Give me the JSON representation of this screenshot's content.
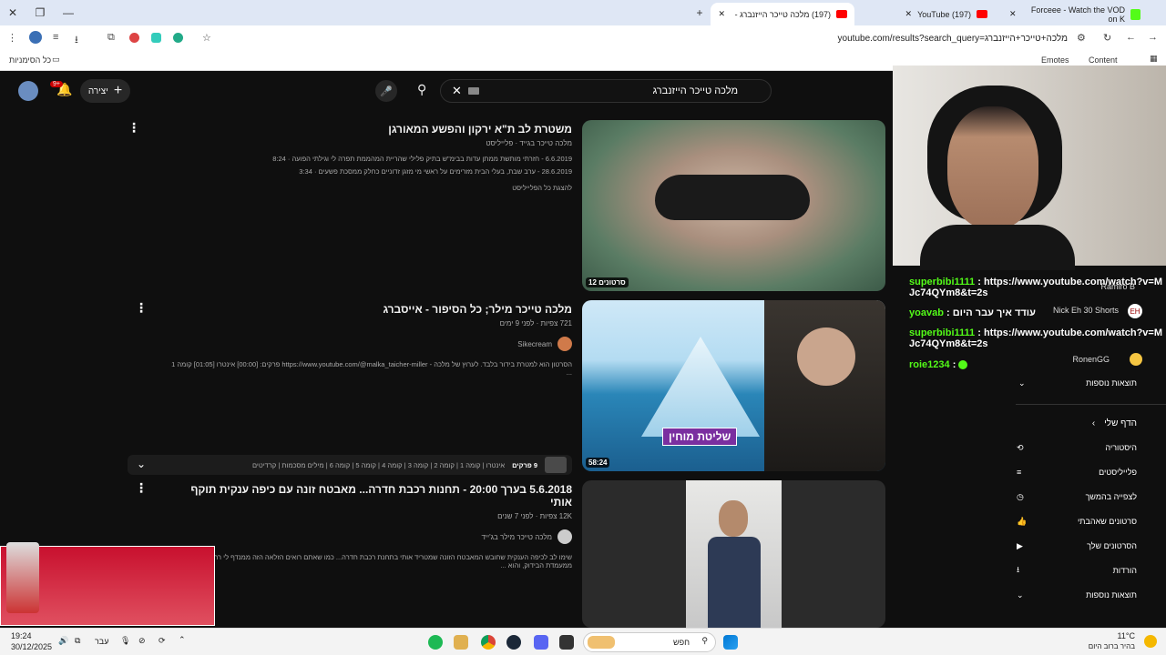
{
  "browser": {
    "tabs": [
      {
        "label": "Forceee - Watch the VOD on K"
      },
      {
        "label": "(197) YouTube"
      },
      {
        "label": "(197) מלכה טייכר הייזנברג - ‏"
      }
    ],
    "url": "youtube.com/results?search_query=מלכה+טייכר+הייזנברג",
    "bookmarks": {
      "all": "כל הסימניות",
      "content": "Content",
      "emotes": "Emotes"
    }
  },
  "yt": {
    "search_value": "מלכה טייכר הייזנברג",
    "create_label": "יצירה",
    "notif_count": "9+",
    "results": [
      {
        "title": "משטרת לב ת\"א ירקון והפשע המאורגן",
        "channel": "מלכה טייכר בגייד · פלייליסט",
        "line1": "6.6.2019 - חזרתי מותשת ממתן עדות בבימ\"ש בתיק פלילי שהריית המהממת תפרה לי וגילתי הפועה · 8:24",
        "line2": "28.6.2019 - ערב שבת, בעלי הבית מזרימים על ראשי מי מזגן זדוניים כחלק ממסכת פשעים · 3:34",
        "link": "להצגת כל הפלייליסט",
        "badge": "12 סרטונים"
      },
      {
        "title": "מלכה טייכר מילר; כל הסיפור - אייסברג",
        "stats": "721 צפיות · לפני 9 ימים",
        "channel": "Sikecream",
        "desc": "הסרטון הוא למטרת בידור בלבד. לערוץ של מלכה - https://www.youtube.com/@malka_taicher-miller פרקים: [00:00] אינטרו [01:05] קומה 1 ...",
        "chapters_label": "9 פרקים",
        "chapters": "אינטרו | קומה 1 | קומה 2 | קומה 3 | קומה 4 | קומה 5 | קומה 6 | מילים מסכמות | קרדיטים",
        "duration": "58:24",
        "overlay_text": "שליטת מוחין"
      },
      {
        "title": "5.6.2018 בערך 20:00 - תחנות רכבת חדרה... מאבטח זונה עם כיפה ענקית תוקף אותי",
        "stats": "12K צפיות · לפני 7 שנים",
        "channel": "מלכה טייכר מילר בג'ייד",
        "desc": "שימו לב לכיפה הענקית שחובש המאבטח הזונה שמטריד אותי בתחנת רכבת חדרה... כמו שאתם רואים הזלאה הזה ממנדף לי רחוק ממעמדת הבידוק, והוא ..."
      }
    ]
  },
  "chat": [
    {
      "user": "superbibi1111",
      "text": "https://www.youtube.com/watch?v=MJc74QYm8&t=2s"
    },
    {
      "user": "yoavab",
      "text": "עודד איך עבר היום"
    },
    {
      "user": "superbibi1111",
      "text": "https://www.youtube.com/watch?v=MJc74QYm8&t=2s"
    },
    {
      "user": "roie1234",
      "text": ""
    }
  ],
  "subs": [
    "Ramiro B",
    "Nick Eh 30 Shorts",
    "RonenGG"
  ],
  "show_more": "תוצאות נוספות",
  "my_page": "הדף שלי",
  "menu": [
    "היסטוריה",
    "פלייליסטים",
    "לצפייה בהמשך",
    "סרטונים שאהבתי",
    "הסרטונים שלך",
    "הורדות",
    "תוצאות נוספות"
  ],
  "taskbar": {
    "weather_temp": "11°C",
    "weather_desc": "בהיר ברוב היום",
    "search": "חפש",
    "lang": "עבר",
    "time": "19:24",
    "date": "30/12/2025"
  }
}
